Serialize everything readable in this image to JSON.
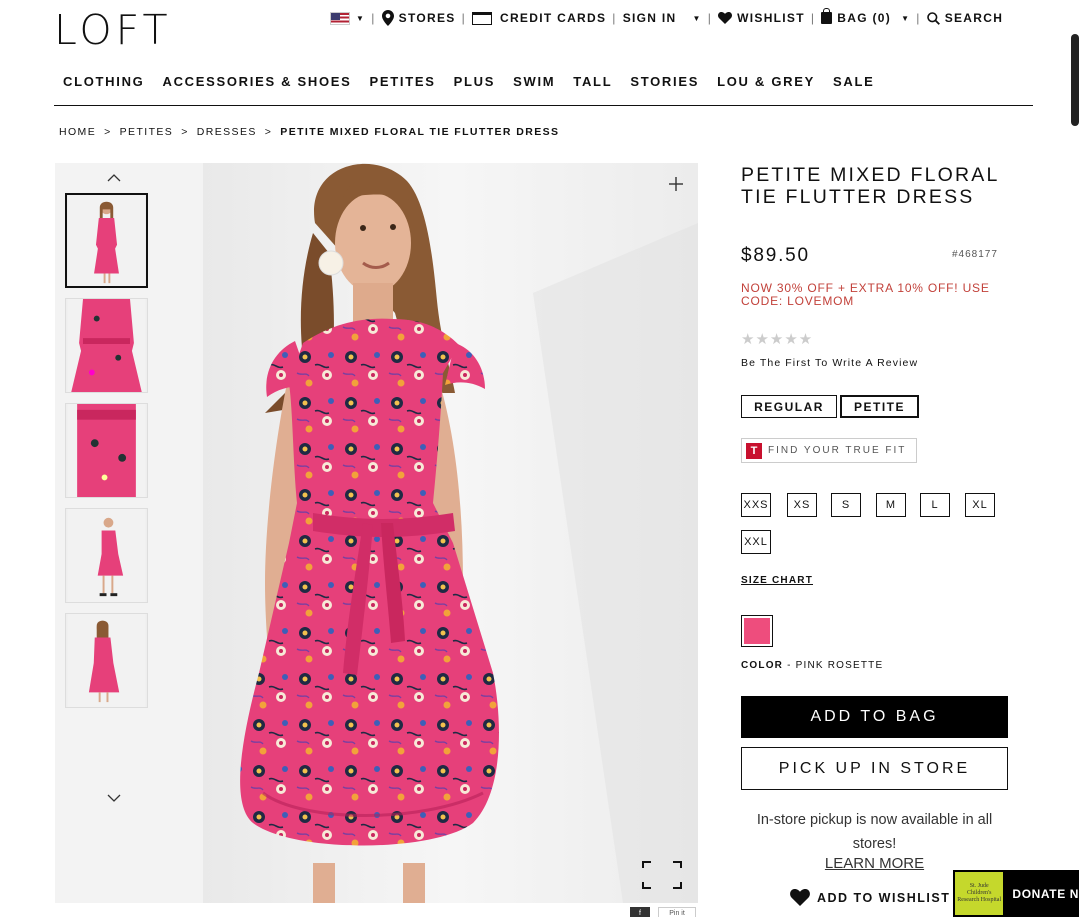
{
  "header": {
    "logo": "LOFT",
    "stores": "STORES",
    "credit_cards": "CREDIT CARDS",
    "sign_in": "SIGN IN",
    "wishlist": "WISHLIST",
    "bag_label": "BAG (",
    "bag_count": "0",
    "bag_close": ")",
    "search": "SEARCH"
  },
  "nav": [
    "CLOTHING",
    "ACCESSORIES & SHOES",
    "PETITES",
    "PLUS",
    "SWIM",
    "TALL",
    "STORIES",
    "LOU & GREY",
    "SALE"
  ],
  "breadcrumb": [
    "HOME",
    "PETITES",
    "DRESSES",
    "PETITE MIXED FLORAL TIE FLUTTER DRESS"
  ],
  "product": {
    "title": "PETITE MIXED FLORAL TIE FLUTTER DRESS",
    "price": "$89.50",
    "sku": "#468177",
    "promo": "NOW 30% OFF + EXTRA 10% OFF! USE CODE: LOVEMOM",
    "rating_stars": "★★★★★",
    "review_link": "Be The First To Write A Review",
    "fits": [
      "REGULAR",
      "PETITE"
    ],
    "selected_fit": "PETITE",
    "true_fit_letter": "T",
    "true_fit": "FIND YOUR TRUE FIT",
    "sizes": [
      "XXS",
      "XS",
      "S",
      "M",
      "L",
      "XL",
      "XXL"
    ],
    "size_chart": "SIZE CHART",
    "color_label": "COLOR",
    "color_sep": " - ",
    "color_name": "PINK ROSETTE",
    "swatch_color": "#ee4d7d",
    "add_to_bag": "ADD TO BAG",
    "pick_up": "PICK UP IN STORE",
    "pickup_message": "In-store pickup is now available in all stores!",
    "learn_more": "LEARN MORE",
    "add_to_wishlist": "ADD TO WISHLIST"
  },
  "donate": {
    "label": "DONATE N",
    "logo_text": "St. Jude Children's Research Hospital"
  },
  "social": {
    "facebook": "f",
    "pinterest": "Pin it"
  },
  "colors": {
    "promo": "#c2413a",
    "dress": "#e6407a",
    "background": "#f3f3f3"
  }
}
